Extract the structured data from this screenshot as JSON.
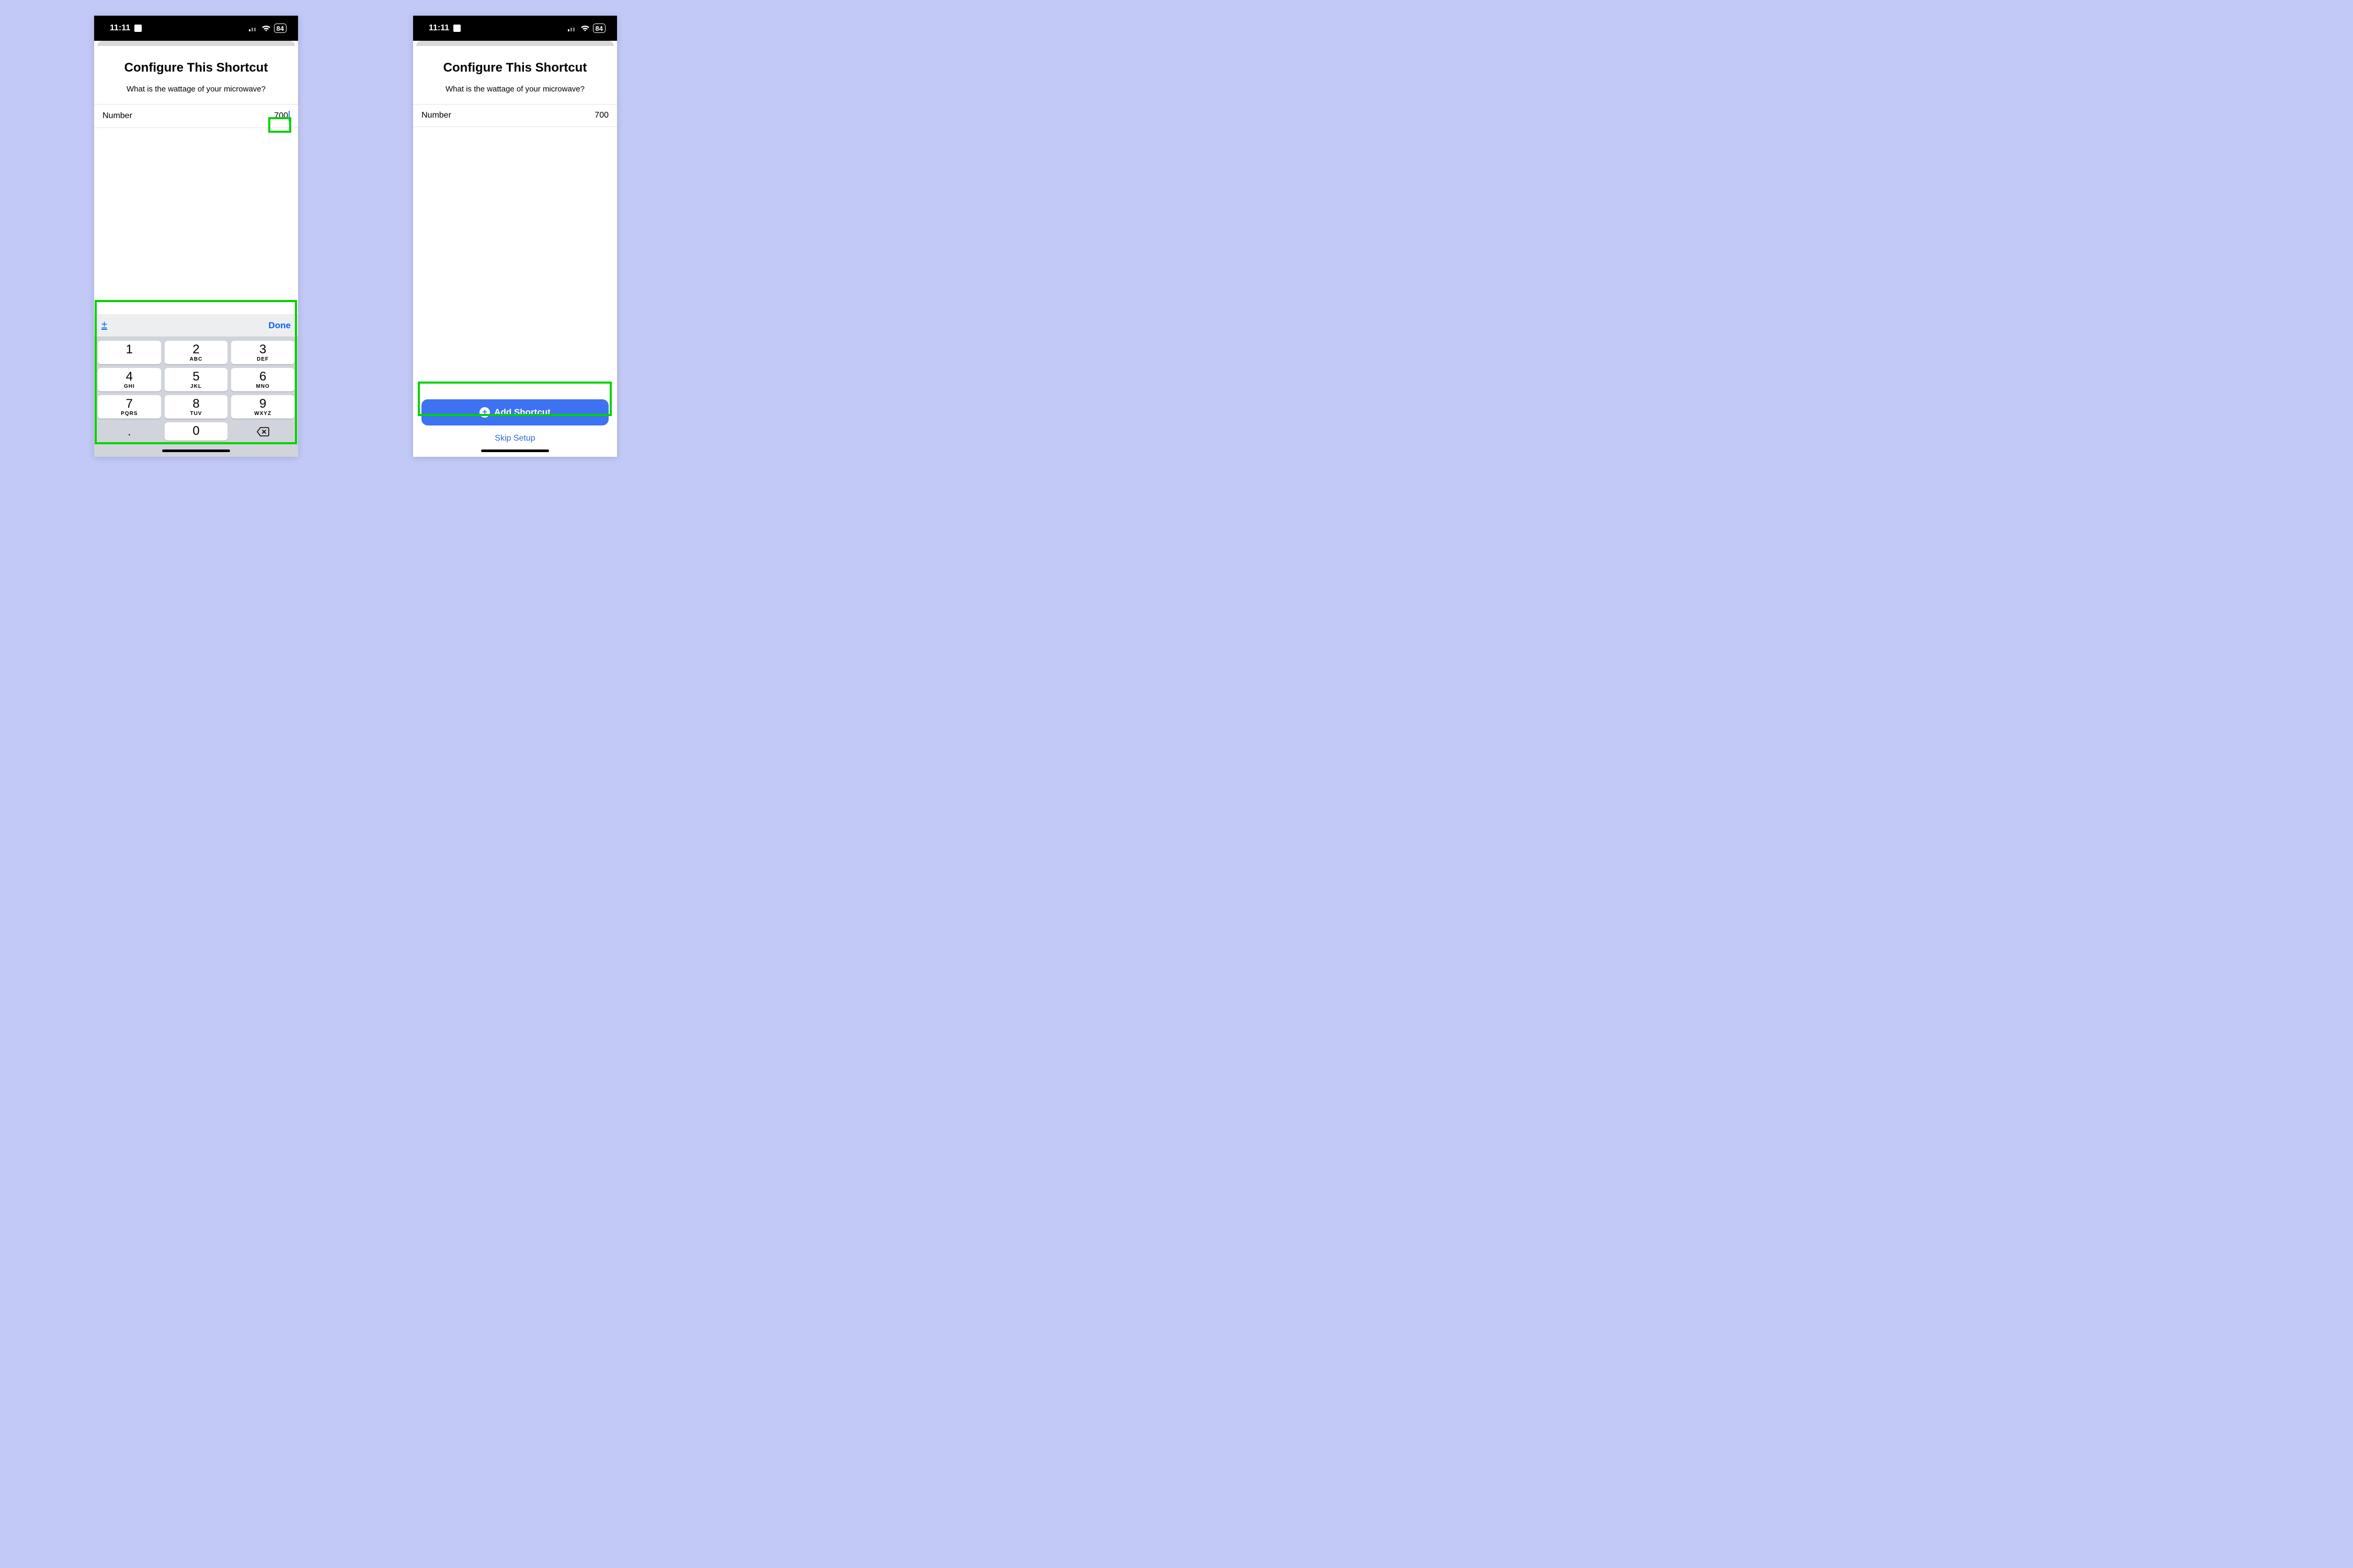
{
  "status": {
    "time": "11:11",
    "battery": "84"
  },
  "sheet": {
    "title": "Configure This Shortcut",
    "subtitle": "What is the wattage of your microwave?",
    "field_label": "Number",
    "field_value": "700"
  },
  "keyboard": {
    "assist_left": "±",
    "assist_done": "Done",
    "keys": [
      {
        "d": "1",
        "l": ""
      },
      {
        "d": "2",
        "l": "ABC"
      },
      {
        "d": "3",
        "l": "DEF"
      },
      {
        "d": "4",
        "l": "GHI"
      },
      {
        "d": "5",
        "l": "JKL"
      },
      {
        "d": "6",
        "l": "MNO"
      },
      {
        "d": "7",
        "l": "PQRS"
      },
      {
        "d": "8",
        "l": "TUV"
      },
      {
        "d": "9",
        "l": "WXYZ"
      }
    ],
    "dot": ".",
    "zero": "0"
  },
  "actions": {
    "add": "Add Shortcut",
    "skip": "Skip Setup"
  }
}
